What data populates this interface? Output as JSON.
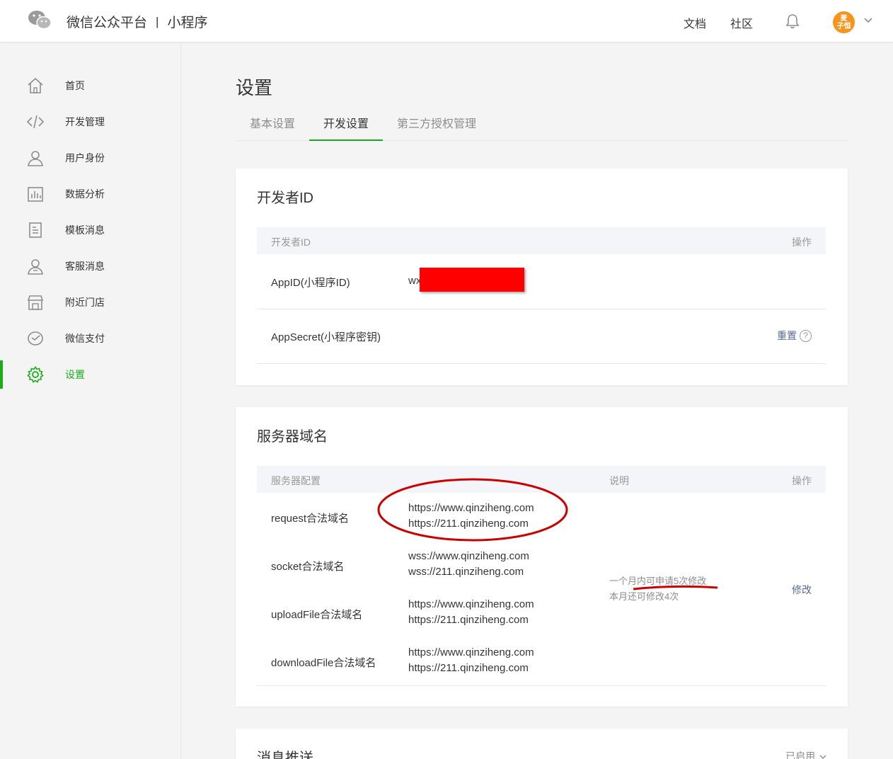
{
  "header": {
    "brand": "微信公众平台",
    "separator": "|",
    "product": "小程序",
    "nav": {
      "docs": "文档",
      "community": "社区"
    },
    "avatar_text_1": "麦",
    "avatar_text_2": "子恒"
  },
  "sidebar": {
    "items": [
      {
        "label": "首页",
        "icon": "home-icon"
      },
      {
        "label": "开发管理",
        "icon": "code-icon"
      },
      {
        "label": "用户身份",
        "icon": "user-icon"
      },
      {
        "label": "数据分析",
        "icon": "chart-icon"
      },
      {
        "label": "模板消息",
        "icon": "document-icon"
      },
      {
        "label": "客服消息",
        "icon": "customer-service-icon"
      },
      {
        "label": "附近门店",
        "icon": "store-icon"
      },
      {
        "label": "微信支付",
        "icon": "payment-icon"
      },
      {
        "label": "设置",
        "icon": "gear-icon",
        "active": true
      }
    ]
  },
  "main": {
    "title": "设置",
    "tabs": [
      {
        "label": "基本设置"
      },
      {
        "label": "开发设置",
        "active": true
      },
      {
        "label": "第三方授权管理"
      }
    ],
    "developer_id": {
      "title": "开发者ID",
      "header_col1": "开发者ID",
      "header_action": "操作",
      "appid_label": "AppID(小程序ID)",
      "appid_value": "wx",
      "secret_label": "AppSecret(小程序密钥)",
      "reset_link": "重置",
      "help_mark": "?"
    },
    "server_domain": {
      "title": "服务器域名",
      "header_col1": "服务器配置",
      "header_col2": "说明",
      "header_action": "操作",
      "rows": [
        {
          "label": "request合法域名",
          "domains": [
            "https://www.qinziheng.com",
            "https://211.qinziheng.com"
          ]
        },
        {
          "label": "socket合法域名",
          "domains": [
            "wss://www.qinziheng.com",
            "wss://211.qinziheng.com"
          ]
        },
        {
          "label": "uploadFile合法域名",
          "domains": [
            "https://www.qinziheng.com",
            "https://211.qinziheng.com"
          ]
        },
        {
          "label": "downloadFile合法域名",
          "domains": [
            "https://www.qinziheng.com",
            "https://211.qinziheng.com"
          ]
        }
      ],
      "note_line1": "一个月内可申请5次修改",
      "note_line2": "本月还可修改4次",
      "modify_link": "修改"
    },
    "message_push": {
      "title": "消息推送",
      "status": "已启用"
    }
  },
  "colors": {
    "accent_green": "#1aad19",
    "link_blue": "#576b95",
    "annotation_red": "#cc0000"
  }
}
